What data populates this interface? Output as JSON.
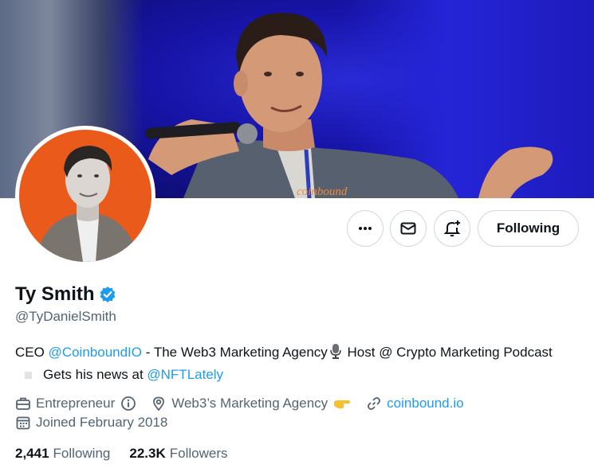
{
  "profile": {
    "name": "Ty Smith",
    "handle": "@TyDanielSmith",
    "verified": true
  },
  "actions": {
    "more_icon": "more-icon",
    "message_icon": "envelope-icon",
    "notify_icon": "bell-plus-icon",
    "follow_label": "Following"
  },
  "bio": {
    "part1": "CEO ",
    "mention1": "@CoinboundIO",
    "part2": " - The Web3 Marketing Agency",
    "part3": " Host @ Crypto Marketing Podcast",
    "part4": "Gets his news at ",
    "mention2": "@NFTLately"
  },
  "meta": {
    "category": "Entrepreneur",
    "location": "Web3’s Marketing Agency",
    "website": "coinbound.io",
    "joined": "Joined February 2018"
  },
  "stats": {
    "following_count": "2,441",
    "following_label": "Following",
    "followers_count": "22.3K",
    "followers_label": "Followers"
  },
  "banner": {
    "shirt_text": "coinbound"
  },
  "colors": {
    "accent": "#1d9bf0",
    "secondary_text": "#536471",
    "avatar_bg": "#ea5a1a",
    "banner_bg": "#1714a8"
  }
}
